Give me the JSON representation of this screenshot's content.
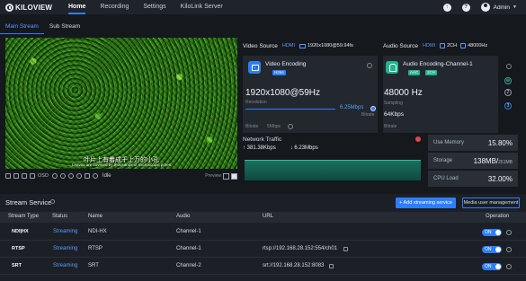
{
  "nav": {
    "logo": "KILOVIEW",
    "items": [
      "Home",
      "Recording",
      "Settings",
      "KiloLink Server"
    ],
    "user": "Admin"
  },
  "stream_tabs": [
    "Main Stream",
    "Sub Stream"
  ],
  "video": {
    "subtitle_cn": "叶片上有着成千上万的小孔",
    "subtitle_en": "Leaves are covered by thousands of microscopic pores"
  },
  "video_toolbar": {
    "osd_label": "OSD",
    "state": "Idle",
    "preview_label": "Preview"
  },
  "video_source": {
    "title": "Video Source",
    "interface": "HDMI",
    "resolution": "1920x1080@59.94fs"
  },
  "audio_source": {
    "title": "Audio Source",
    "interface": "HDMI",
    "channels": "2CH",
    "sample_rate": "48000Hz"
  },
  "video_encoding": {
    "title": "Video Encoding",
    "codec_tag": "H264",
    "resolution": "1920x1080@59Hz",
    "resolution_label": "Resolution",
    "bitrate_value": "6.25Mbps",
    "bitrate_label": "Bitrate",
    "bitrate_mode_label": "Bitrate",
    "bitrate_mode": "5Mbps"
  },
  "audio_encoding": {
    "title": "Audio Encoding-Channel-1",
    "codec_tag": "AAC",
    "channel_tag": "2CH",
    "sampling": "48000 Hz",
    "sampling_label": "Sampling",
    "bitrate": "64Kbps",
    "bitrate_label": "Bitrate"
  },
  "side_mini": [
    "2",
    "3"
  ],
  "network": {
    "title": "Network Traffic",
    "upload": "381.38Kbps",
    "download": "6.23Mbps"
  },
  "usage": [
    {
      "label": "Use Memory",
      "value": "15.80%",
      "unit": ""
    },
    {
      "label": "Storage",
      "value": "138MB/",
      "unit": "251MB"
    },
    {
      "label": "CPU Load",
      "value": "32.00%",
      "unit": ""
    }
  ],
  "stream_service": {
    "title": "Stream Service",
    "add_button": "+ Add streaming service",
    "mgmt_button": "Media user management",
    "headers": [
      "Stream Type",
      "Status",
      "Name",
      "Audio",
      "URL",
      "Operation"
    ],
    "rows": [
      {
        "type": "NDI|HX",
        "status": "Streaming",
        "name": "NDI-HX",
        "audio": "Channel-1",
        "url": "",
        "toggle": "ON"
      },
      {
        "type": "RTSP",
        "status": "Streaming",
        "name": "RTSP",
        "audio": "Channel-1",
        "url": "rtsp://192.168.28.152:554/ch01",
        "toggle": "ON"
      },
      {
        "type": "SRT",
        "status": "Streaming",
        "name": "SRT",
        "audio": "Channel-2",
        "url": "srt://192.168.28.152:8083",
        "toggle": "ON"
      }
    ]
  }
}
